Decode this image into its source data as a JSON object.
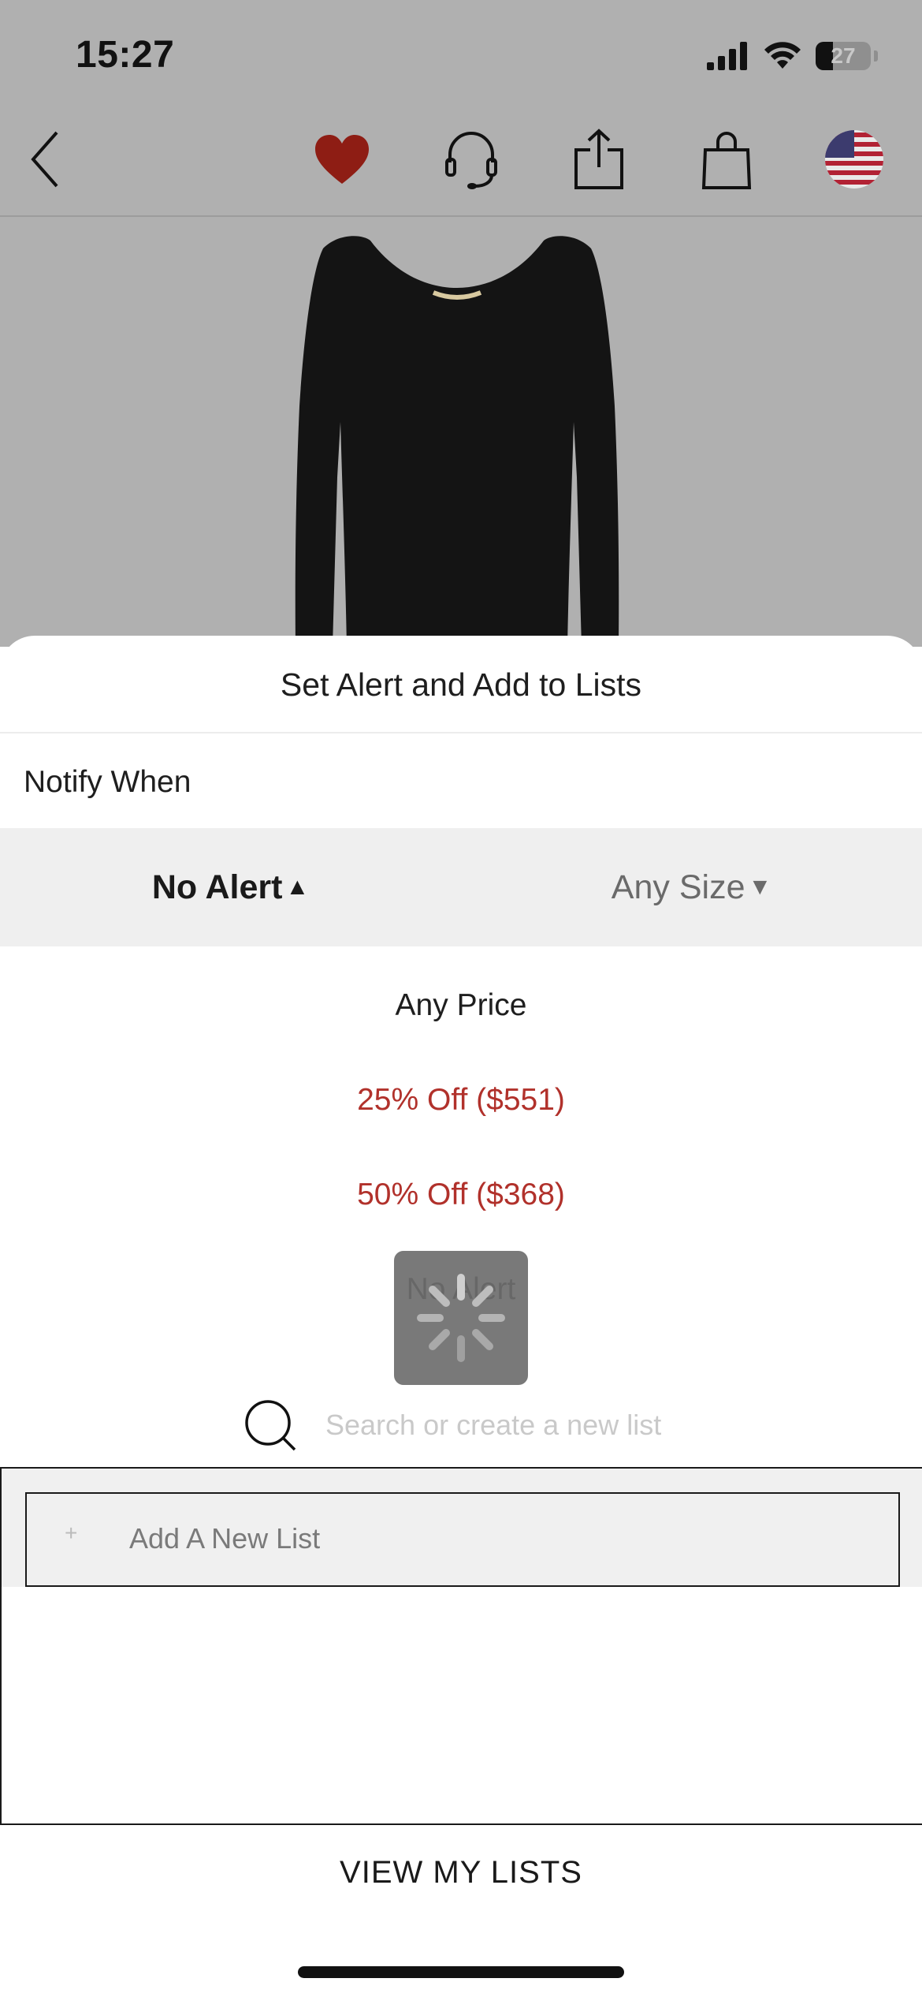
{
  "status_bar": {
    "time": "15:27",
    "battery": "27",
    "icons": [
      "signal-icon",
      "wifi-icon",
      "battery-icon"
    ]
  },
  "top_nav": {
    "icons": [
      "back-chevron-icon",
      "heart-icon",
      "headset-icon",
      "share-icon",
      "shopping-bag-icon",
      "us-flag-icon"
    ],
    "heart_color": "#8e1d14"
  },
  "product": {
    "image": "black-ribbed-long-sleeve-dress"
  },
  "sheet": {
    "title": "Set Alert and Add to Lists",
    "notify_label": "Notify When",
    "tabs": {
      "alert_label": "No Alert",
      "size_label": "Any Size"
    },
    "alert_options": [
      {
        "label": "Any Price"
      },
      {
        "label": "25% Off ($551)"
      },
      {
        "label": "50% Off ($368)"
      },
      {
        "label": "No Alert"
      }
    ],
    "search_placeholder": "Search or create a new list",
    "add_new_plus": "+",
    "add_new_label": "Add A New List",
    "view_lists": "VIEW MY LISTS"
  },
  "colors": {
    "accent_red": "#b1312b",
    "overlay": "#b0b0b0"
  }
}
